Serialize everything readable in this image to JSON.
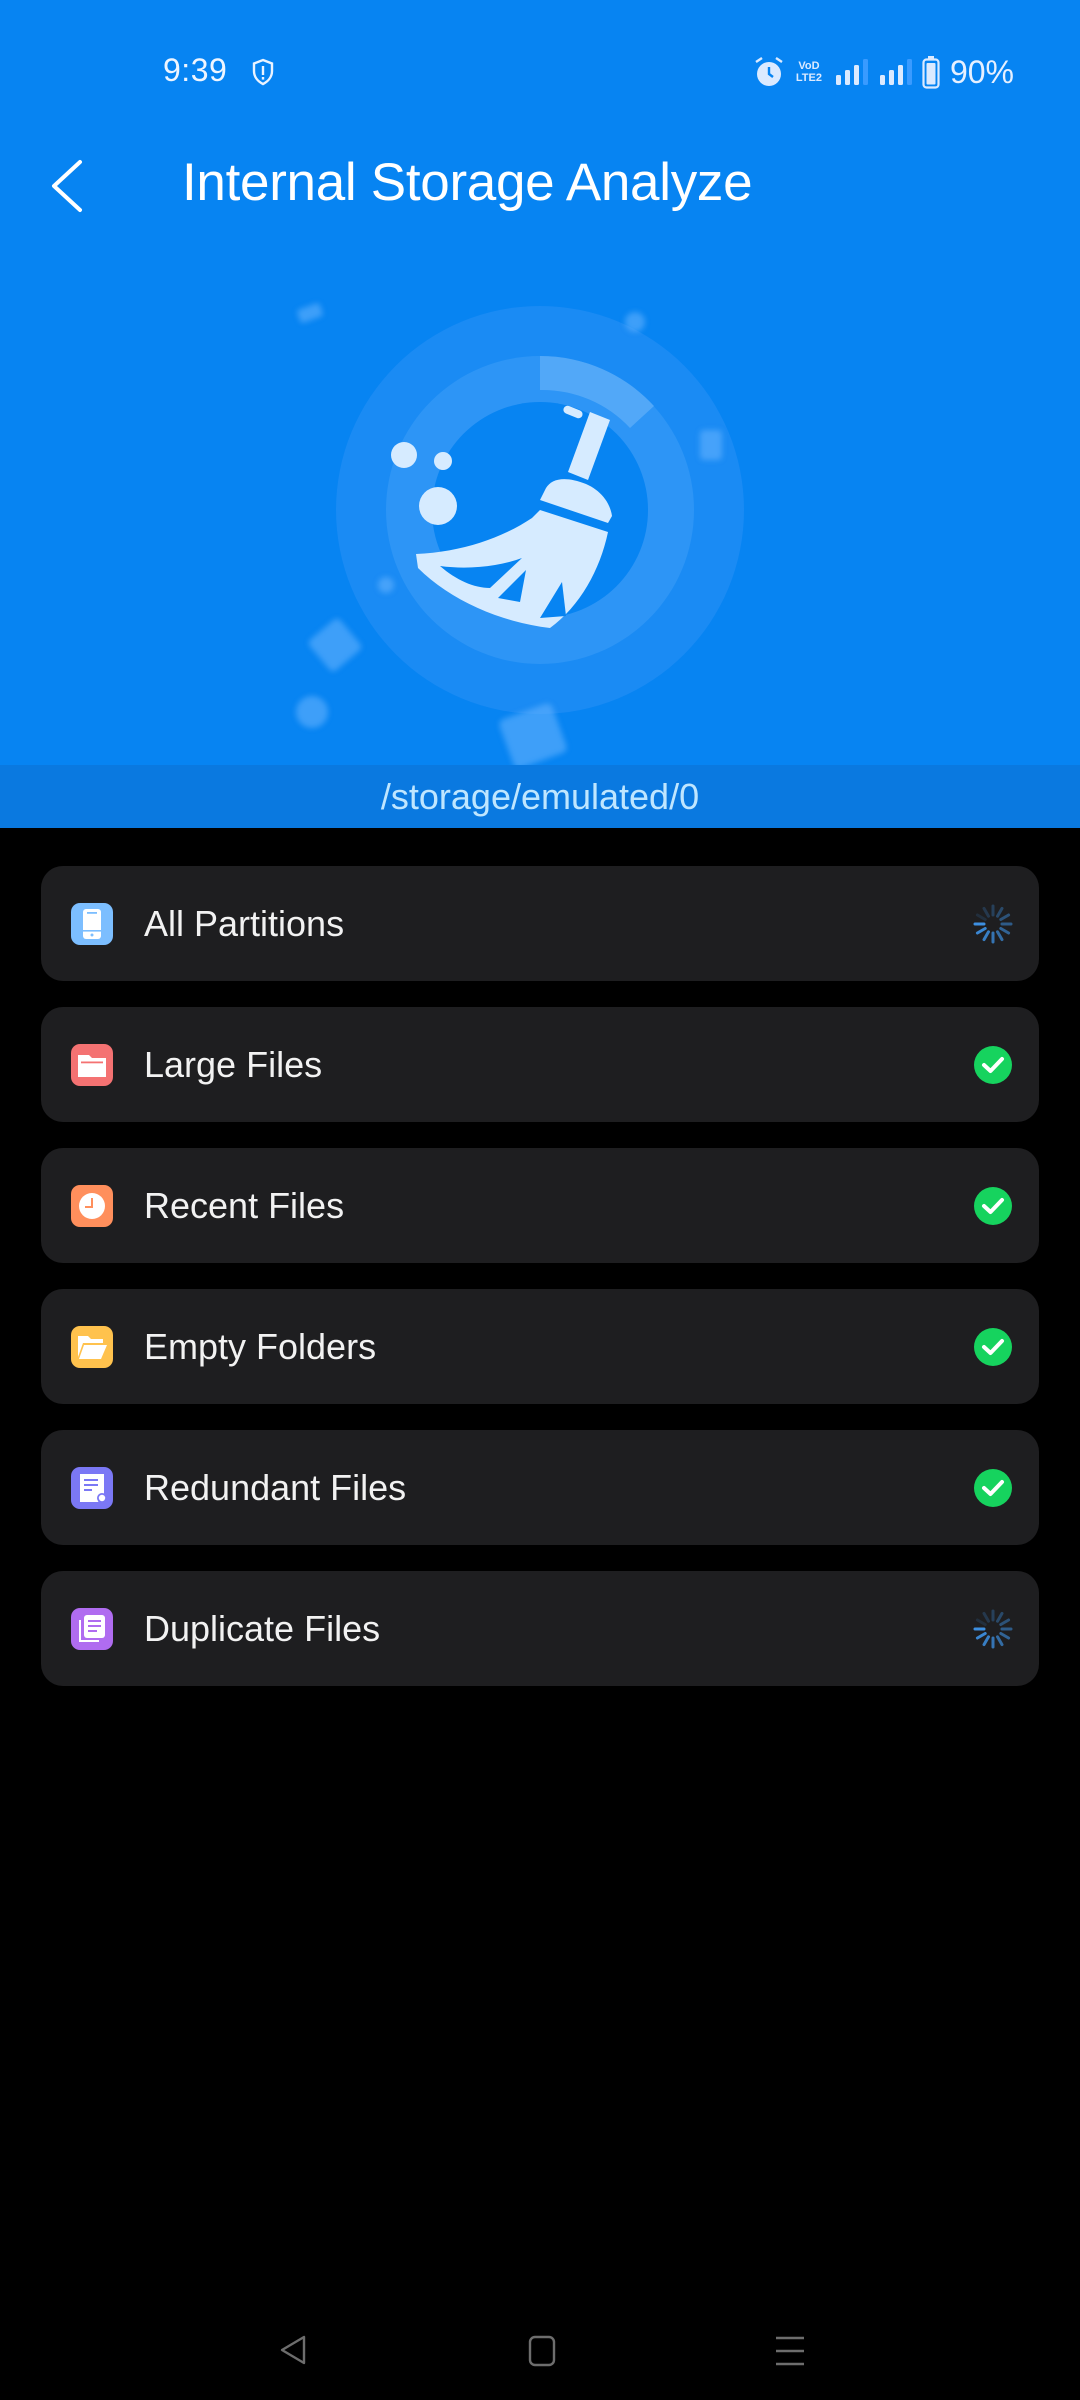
{
  "status_bar": {
    "time": "9:39",
    "left_icons": [
      "shield-alert-icon"
    ],
    "right_icons": [
      "alarm-icon",
      "volte-lte2-icon",
      "signal-sim1-icon",
      "signal-sim2-icon",
      "battery-icon"
    ],
    "volte_line1": "VoD",
    "volte_line2": "LTE2",
    "battery_percent": "90%"
  },
  "header": {
    "back_icon": "chevron-left-icon",
    "title": "Internal Storage Analyze",
    "illustration": "broom-cleaning-icon"
  },
  "path": {
    "text": "/storage/emulated/0"
  },
  "colors": {
    "header_bg": "#0784F2",
    "path_bg": "#0A79E0",
    "card_bg": "#1E1E20",
    "success": "#16D35E",
    "spinner": "#3D8FE0"
  },
  "items": [
    {
      "label": "All Partitions",
      "icon": "phone-icon",
      "icon_color": "#7CBEFF",
      "status": "loading"
    },
    {
      "label": "Large Files",
      "icon": "folder-icon",
      "icon_color": "#F47272",
      "status": "done"
    },
    {
      "label": "Recent Files",
      "icon": "clock-icon",
      "icon_color": "#FF8F5C",
      "status": "done"
    },
    {
      "label": "Empty Folders",
      "icon": "open-folder-icon",
      "icon_color": "#FFC24D",
      "status": "done"
    },
    {
      "label": "Redundant Files",
      "icon": "document-icon",
      "icon_color": "#7B78F5",
      "status": "done"
    },
    {
      "label": "Duplicate Files",
      "icon": "copy-documents-icon",
      "icon_color": "#B06CF0",
      "status": "loading"
    }
  ],
  "nav_bar": {
    "buttons": [
      "back-nav",
      "home-nav",
      "recents-nav"
    ]
  }
}
